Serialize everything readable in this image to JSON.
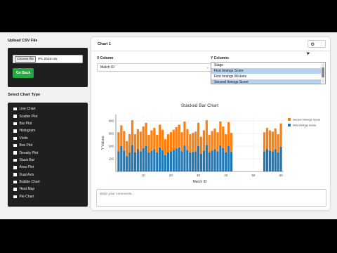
{
  "left": {
    "upload_title": "Upload CSV File",
    "choose_file_label": "Choose file",
    "file_name": "IPL 2018.csv",
    "go_back_label": "Go Back",
    "chart_type_title": "Select Chart Type",
    "chart_types": [
      {
        "label": "Line Chart",
        "checked": false
      },
      {
        "label": "Scatter Plot",
        "checked": false
      },
      {
        "label": "Bar Plot",
        "checked": false
      },
      {
        "label": "Histogram",
        "checked": false
      },
      {
        "label": "Violin",
        "checked": false
      },
      {
        "label": "Box Plot",
        "checked": false
      },
      {
        "label": "Density Plot",
        "checked": false
      },
      {
        "label": "Stack Bar",
        "checked": true
      },
      {
        "label": "Area Plot",
        "checked": false
      },
      {
        "label": "Dual Axis",
        "checked": false
      },
      {
        "label": "Bubble Chart",
        "checked": false
      },
      {
        "label": "Heat Map",
        "checked": false
      },
      {
        "label": "Pie Chart",
        "checked": false
      }
    ]
  },
  "card": {
    "title": "Chart 1",
    "gear_icon": "gear-icon",
    "more_icon": "more-icon",
    "x_label": "X Column",
    "x_value": "Match ID",
    "y_label": "Y Columns",
    "y_options": [
      {
        "label": "Stage",
        "selected": false
      },
      {
        "label": "First Innings Score",
        "selected": true
      },
      {
        "label": "First Innings Wickets",
        "selected": false
      },
      {
        "label": "Second Innings Score",
        "selected": true
      }
    ],
    "comment_placeholder": "Write your comments..."
  },
  "chart_data": {
    "type": "bar",
    "stacked": true,
    "title": "Stacked Bar Chart",
    "xlabel": "Match ID",
    "ylabel": "Y Values",
    "xlim": [
      0,
      61
    ],
    "ylim": [
      0,
      450
    ],
    "xticks": [
      10,
      20,
      30,
      40,
      50,
      60
    ],
    "yticks": [
      100,
      200,
      300,
      400
    ],
    "ytick_labels": [
      "100",
      "200",
      "300",
      "400"
    ],
    "legend_position": "top-right",
    "colors": {
      "first": "#1f77b4",
      "second": "#ff7f0e"
    },
    "x": [
      1,
      2,
      3,
      4,
      5,
      6,
      7,
      8,
      9,
      10,
      11,
      12,
      13,
      14,
      15,
      16,
      17,
      18,
      19,
      20,
      21,
      22,
      23,
      24,
      25,
      26,
      27,
      28,
      29,
      30,
      31,
      32,
      33,
      34,
      35,
      36,
      37,
      38,
      39,
      40,
      41,
      42,
      43,
      44,
      45,
      46,
      47,
      48,
      49,
      50,
      51,
      52,
      53,
      54,
      55,
      56,
      57,
      58,
      59,
      60
    ],
    "series": [
      {
        "name": "First Innings Score",
        "values": [
          160,
          200,
          165,
          120,
          150,
          210,
          150,
          175,
          160,
          185,
          200,
          150,
          165,
          175,
          150,
          190,
          170,
          130,
          150,
          160,
          170,
          180,
          190,
          160,
          205,
          170,
          150,
          155,
          160,
          200,
          140,
          165,
          210,
          150,
          165,
          175,
          160,
          205,
          185,
          150,
          200,
          155,
          0,
          0,
          0,
          0,
          0,
          0,
          0,
          0,
          0,
          0,
          0,
          160,
          175,
          165,
          160,
          175,
          150,
          195
        ]
      },
      {
        "name": "Second Innings Score",
        "values": [
          150,
          165,
          155,
          120,
          145,
          195,
          145,
          160,
          155,
          170,
          185,
          140,
          160,
          170,
          140,
          180,
          160,
          125,
          145,
          150,
          160,
          170,
          180,
          150,
          190,
          165,
          145,
          150,
          155,
          185,
          135,
          160,
          195,
          140,
          155,
          165,
          150,
          190,
          170,
          145,
          190,
          150,
          0,
          0,
          0,
          0,
          0,
          0,
          0,
          0,
          0,
          0,
          0,
          150,
          170,
          160,
          155,
          165,
          145,
          185
        ]
      }
    ]
  }
}
